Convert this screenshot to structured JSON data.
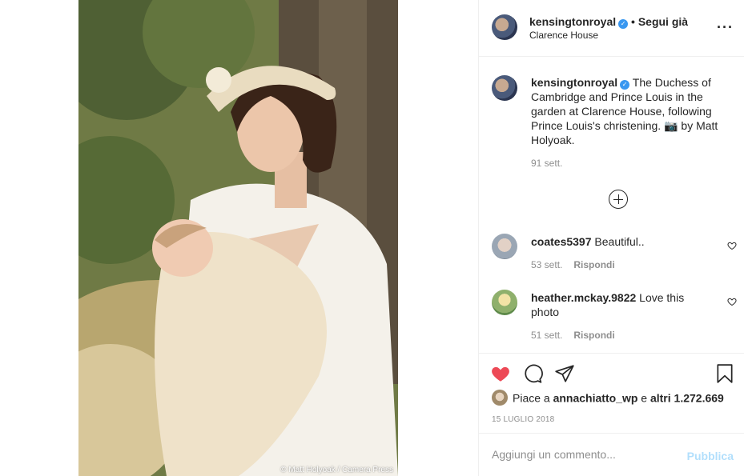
{
  "photo": {
    "credit": "© Matt Holyoak / Camera Press"
  },
  "header": {
    "username": "kensingtonroyal",
    "follow_status": "• Segui già",
    "location": "Clarence House",
    "more_icon": "more-icon"
  },
  "caption": {
    "username": "kensingtonroyal",
    "text": "The Duchess of Cambridge and Prince Louis in the garden at Clarence House, following Prince Louis's christening. 📷 by Matt Holyoak.",
    "time": "91 sett."
  },
  "comments": [
    {
      "username": "coates5397",
      "text": "Beautiful..",
      "time": "53 sett.",
      "reply_label": "Rispondi"
    },
    {
      "username": "heather.mckay.9822",
      "text": "Love this photo",
      "time": "51 sett.",
      "reply_label": "Rispondi"
    }
  ],
  "actions": {
    "liked": true,
    "like_color": "#ed4956",
    "likes_prefix": "Piace a",
    "likes_user": "annachiatto_wp",
    "likes_mid": "e",
    "likes_others": "altri 1.272.669",
    "date": "15 LUGLIO 2018"
  },
  "add_comment": {
    "placeholder": "Aggiungi un commento...",
    "publish_label": "Pubblica"
  },
  "colors": {
    "verified": "#3897f0",
    "muted_text": "#8e8e8e",
    "publish_disabled": "#b2dffc"
  }
}
